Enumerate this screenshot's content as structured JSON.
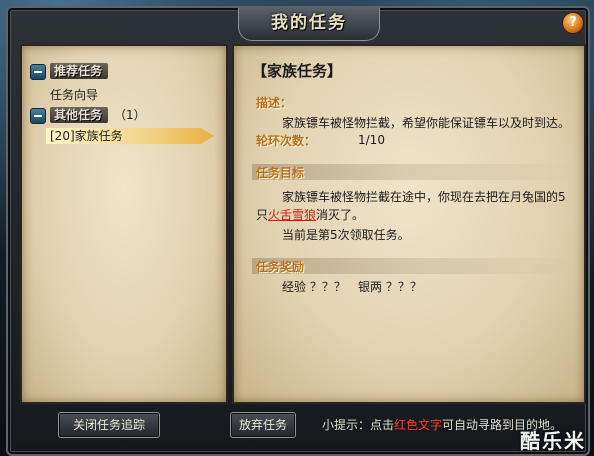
{
  "window": {
    "title": "我的任务",
    "help_label": "?"
  },
  "tree": {
    "recommended": {
      "label": "推荐任务",
      "items": [
        "任务向导"
      ]
    },
    "other": {
      "label": "其他任务",
      "count": "（1）",
      "items": [
        "[20]家族任务"
      ]
    }
  },
  "detail": {
    "title": "【家族任务】",
    "description_label": "描述：",
    "description": "家族镖车被怪物拦截，希望你能保证镖车以及时到达。",
    "rounds_label": "轮环次数：",
    "rounds_value": "1/10",
    "objective_label": "任务目标",
    "objective_part1": "家族镖车被怪物拦截在途中，你现在去把在月兔国的5",
    "objective_part2_prefix": "只",
    "objective_link": "火舌雪狼",
    "objective_part2_suffix": "消灭了。",
    "objective_part3": "当前是第5次领取任务。",
    "reward_label": "任务奖励",
    "reward_exp": "经验 ？？？",
    "reward_money": "银两 ？？？"
  },
  "footer": {
    "close_tracking_label": "关闭任务追踪",
    "abandon_label": "放弃任务",
    "hint_prefix": "小提示：点击",
    "hint_red": "红色文字",
    "hint_suffix": "可自动寻路到目的地。"
  },
  "watermark": "酷乐米",
  "colors": {
    "section_label": "#b5701c",
    "red_link": "#d21a0f",
    "selected_highlight": "#e9b040"
  }
}
